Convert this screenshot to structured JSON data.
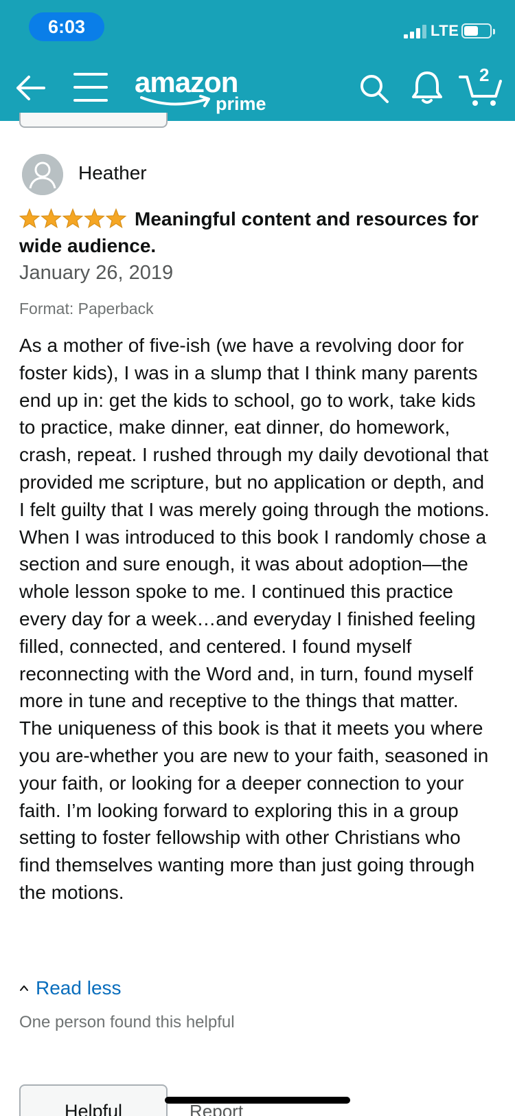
{
  "status_bar": {
    "time": "6:03",
    "network": "LTE"
  },
  "nav": {
    "logo_text": "amazon",
    "logo_subtext": "prime",
    "cart_count": "2",
    "colors": {
      "header_bg": "#18a2b8",
      "time_pill": "#0a7ee8"
    },
    "icons": [
      "back-arrow-icon",
      "hamburger-menu-icon",
      "search-icon",
      "bell-icon",
      "cart-icon"
    ]
  },
  "review": {
    "reviewer_name": "Heather",
    "rating": 5,
    "rating_max": 5,
    "title": "Meaningful content and resources for wide audience.",
    "date": "January 26, 2019",
    "format": "Format: Paperback",
    "body": "As a mother of five-ish (we have a revolving door for foster kids), I was in a slump that I think many parents end up in: get the kids to school, go to work, take kids to practice, make dinner, eat dinner, do homework, crash, repeat. I rushed through my daily devotional that provided me scripture, but no application or depth, and I felt guilty that I was merely going through the motions. When I was introduced to this book I randomly chose a section and sure enough, it was about adoption—the whole lesson spoke to me. I continued this practice every day for a week…and everyday I finished feeling filled, connected, and centered. I found myself reconnecting with the Word and, in turn, found myself more in tune and receptive to the things that matter. The uniqueness of this book is that it meets you where you are-whether you are new to your faith, seasoned in your faith, or looking for a deeper connection to your faith. I’m looking forward to exploring this in a group setting to foster fellowship with other Christians who find themselves wanting more than just going through the motions.",
    "read_less_label": "Read less",
    "helpful_count_text": "One person found this helpful",
    "helpful_button_label": "Helpful",
    "report_label": "Report",
    "colors": {
      "star": "#f5a623",
      "link": "#0a6ebd"
    }
  }
}
